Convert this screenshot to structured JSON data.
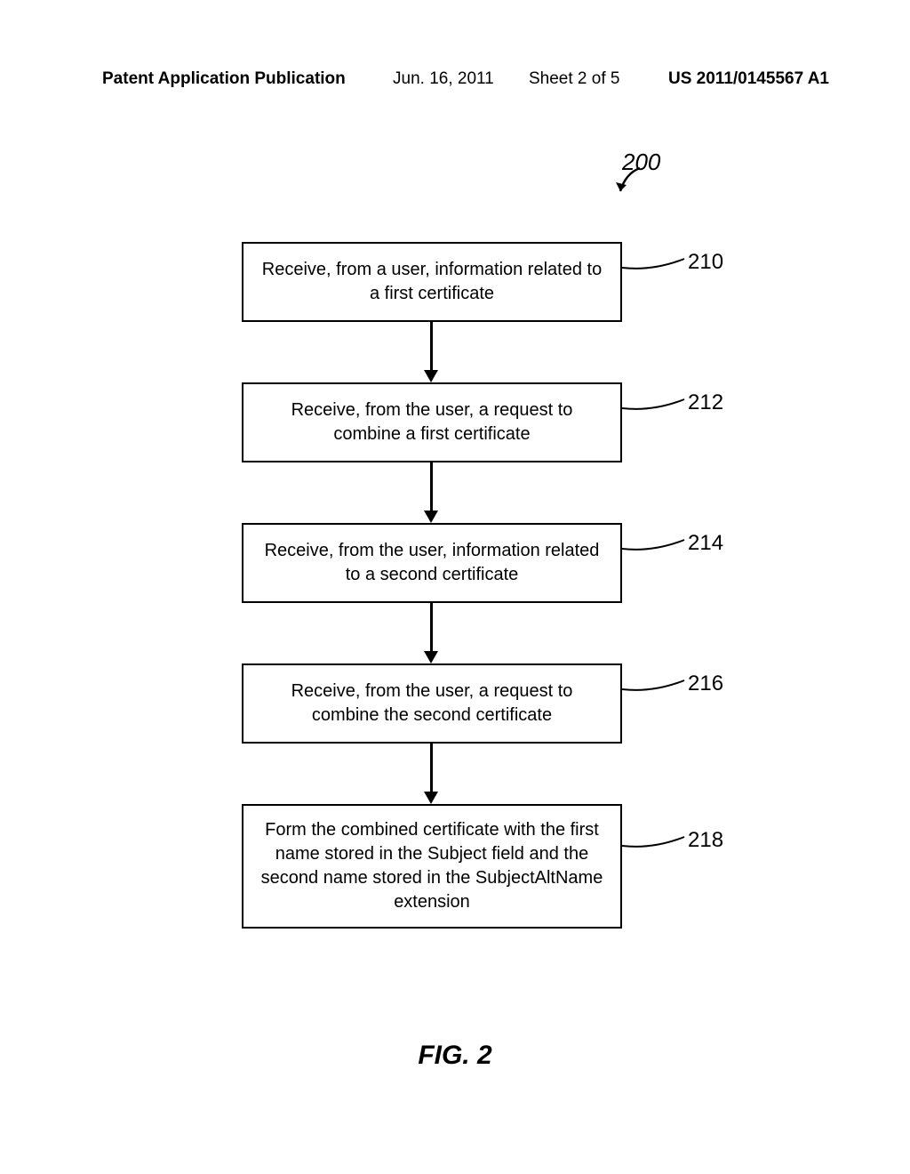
{
  "header": {
    "left": "Patent Application Publication",
    "date": "Jun. 16, 2011",
    "sheet": "Sheet 2 of 5",
    "pubno": "US 2011/0145567 A1"
  },
  "diagram": {
    "ref_main": "200",
    "steps": [
      {
        "ref": "210",
        "text": "Receive, from a user, information related to a first certificate"
      },
      {
        "ref": "212",
        "text": "Receive, from the user, a request to combine a first certificate"
      },
      {
        "ref": "214",
        "text": "Receive, from the user, information related to a second certificate"
      },
      {
        "ref": "216",
        "text": "Receive, from the user, a request to combine the second certificate"
      },
      {
        "ref": "218",
        "text": "Form the combined certificate with the first name stored in the Subject field and the second name stored in the SubjectAltName extension"
      }
    ],
    "caption": "FIG. 2"
  }
}
